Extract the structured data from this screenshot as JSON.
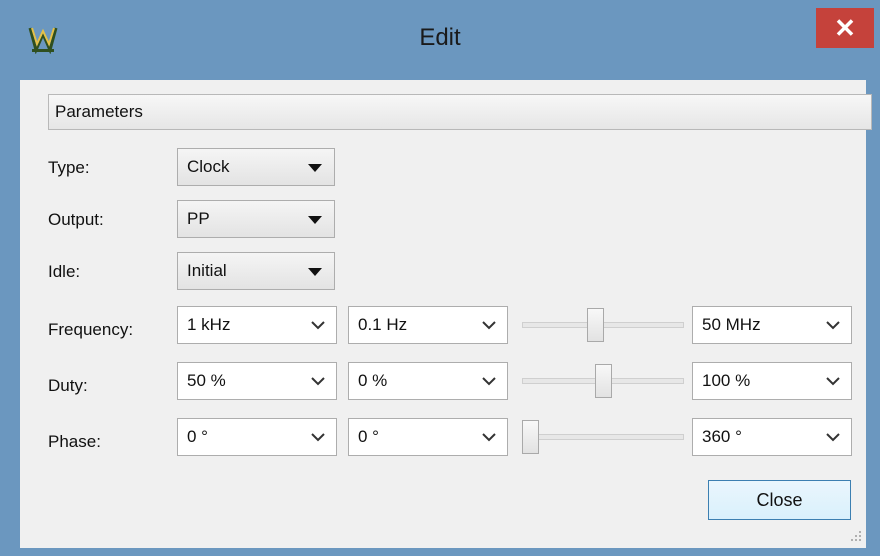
{
  "window": {
    "title": "Edit",
    "close_glyph": "✕"
  },
  "section": {
    "title": "Parameters"
  },
  "rows": {
    "type": {
      "label": "Type:",
      "value": "Clock"
    },
    "output": {
      "label": "Output:",
      "value": "PP"
    },
    "idle": {
      "label": "Idle:",
      "value": "Initial"
    },
    "frequency": {
      "label": "Frequency:",
      "value": "1 kHz",
      "min": "0.1 Hz",
      "max": "50 MHz",
      "slider_position": 0.45
    },
    "duty": {
      "label": "Duty:",
      "value": "50 %",
      "min": "0 %",
      "max": "100 %",
      "slider_position": 0.5
    },
    "phase": {
      "label": "Phase:",
      "value": "0 °",
      "min": "0 °",
      "max": "360 °",
      "slider_position": 0.0
    }
  },
  "buttons": {
    "close": "Close"
  },
  "icons": {
    "app": "app-logo-icon",
    "dropdown": "triangle-down-icon",
    "combo": "chevron-down-icon",
    "grip": "resize-grip-icon"
  },
  "colors": {
    "titlebar": "#6b97bf",
    "close_button": "#c5423b",
    "default_button_border": "#3c7fb1"
  }
}
